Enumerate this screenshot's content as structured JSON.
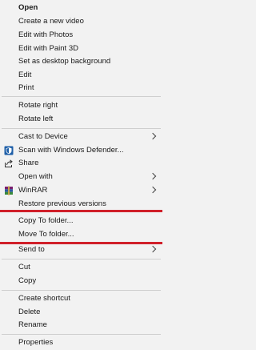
{
  "menu": {
    "items": [
      {
        "label": "Open"
      },
      {
        "label": "Create a new video"
      },
      {
        "label": "Edit with Photos"
      },
      {
        "label": "Edit with Paint 3D"
      },
      {
        "label": "Set as desktop background"
      },
      {
        "label": "Edit"
      },
      {
        "label": "Print"
      },
      {
        "label": "Rotate right"
      },
      {
        "label": "Rotate left"
      },
      {
        "label": "Cast to Device"
      },
      {
        "label": "Scan with Windows Defender..."
      },
      {
        "label": "Share"
      },
      {
        "label": "Open with"
      },
      {
        "label": "WinRAR"
      },
      {
        "label": "Restore previous versions"
      },
      {
        "label": "Copy To folder..."
      },
      {
        "label": "Move To folder..."
      },
      {
        "label": "Send to"
      },
      {
        "label": "Cut"
      },
      {
        "label": "Copy"
      },
      {
        "label": "Create shortcut"
      },
      {
        "label": "Delete"
      },
      {
        "label": "Rename"
      },
      {
        "label": "Properties"
      }
    ]
  },
  "colors": {
    "background": "#f2f2f2",
    "highlight_line": "#d0202a",
    "separator": "#cfcfcf"
  }
}
